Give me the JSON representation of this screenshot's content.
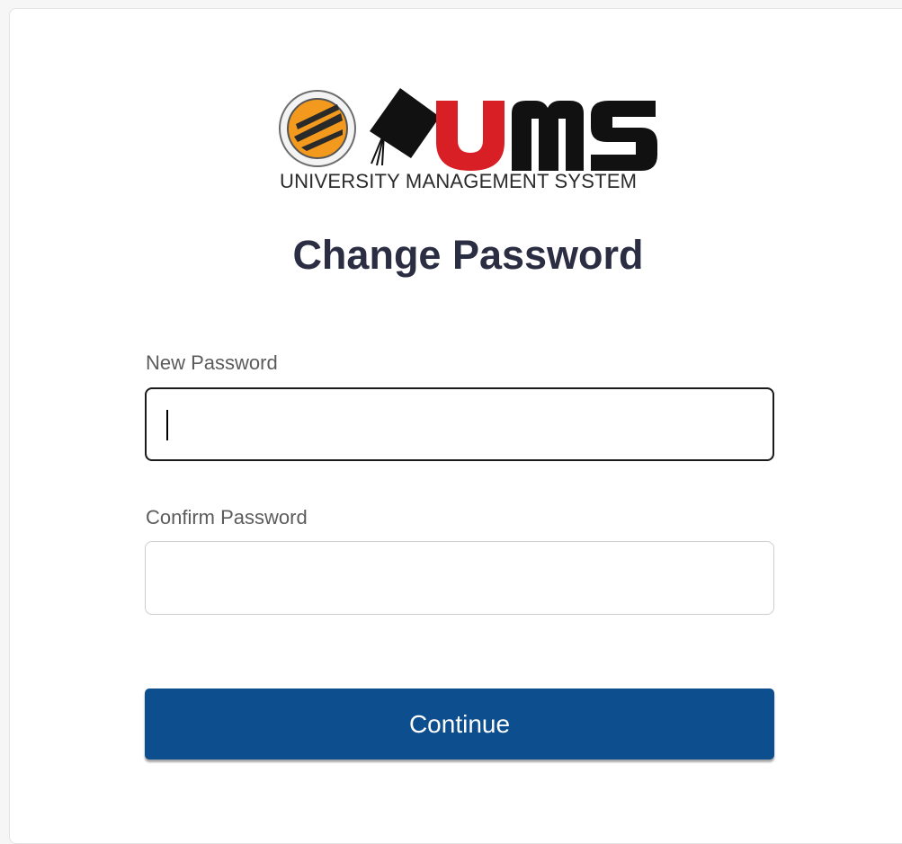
{
  "logo": {
    "brand_text": "UMS",
    "tagline": "UNIVERSITY MANAGEMENT SYSTEM"
  },
  "page": {
    "title": "Change Password"
  },
  "form": {
    "new_password": {
      "label": "New Password",
      "value": "",
      "placeholder": "",
      "focused": true
    },
    "confirm_password": {
      "label": "Confirm Password",
      "value": "",
      "placeholder": ""
    },
    "continue_label": "Continue"
  },
  "colors": {
    "primary_button": "#0d4f8e",
    "title_text": "#2b2e42",
    "logo_red": "#d81f26",
    "logo_black": "#111111",
    "seal_orange": "#f39a1e"
  },
  "icons": [
    "university-seal-icon",
    "graduation-cap-icon"
  ]
}
